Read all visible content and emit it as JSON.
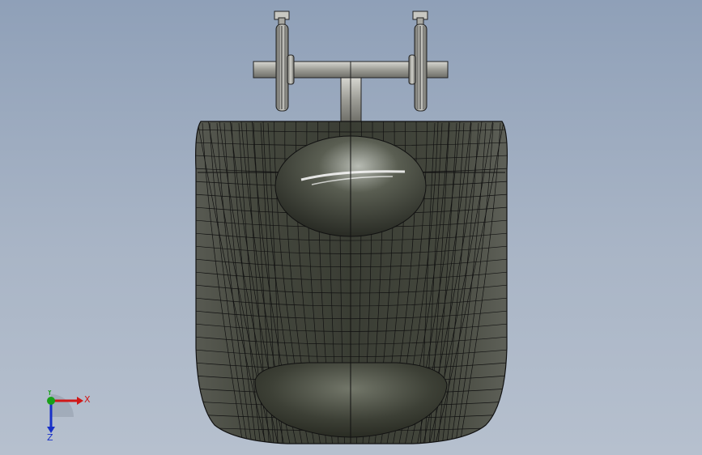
{
  "viewport": {
    "background_top": "#8fa0b8",
    "background_bottom": "#b6c0ce"
  },
  "model": {
    "body_color": "#3d4036",
    "mesh_color": "#111111",
    "highlight_color": "#f2f2f2",
    "wheel_color": "#9a9a94",
    "icon_name": "cad-body-front-view"
  },
  "triad": {
    "x_label": "X",
    "y_label": "Y",
    "z_label": "Z",
    "x_color": "#d01818",
    "y_color": "#18a018",
    "z_color": "#1830c8"
  }
}
